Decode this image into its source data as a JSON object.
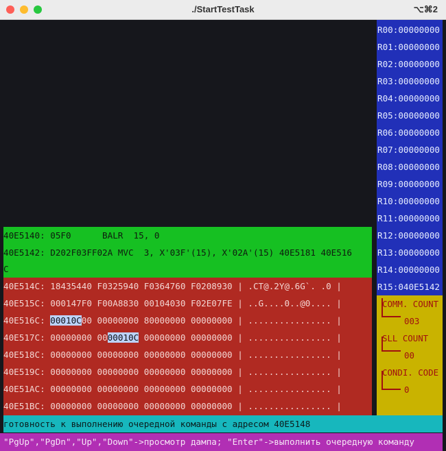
{
  "window": {
    "title": "./StartTestTask",
    "shortcut": "⌥⌘2"
  },
  "disasm": [
    "40E5140: 05F0      BALR  15, 0",
    "40E5142: D202F03FF02A MVC  3, X'03F'(15), X'02A'(15) 40E5181 40E516",
    "C"
  ],
  "dump": [
    {
      "addr": "40E514C:",
      "pre": "",
      "hl": "",
      "mid": "18435440 F0325940 F0364760 F0208930",
      "hl2": "",
      "post": "",
      "ascii": " | .CT@.2Y@.6G`. .0 |"
    },
    {
      "addr": "40E515C:",
      "pre": "",
      "hl": "",
      "mid": "000147F0 F00A8830 00104030 F02E07FE",
      "hl2": "",
      "post": "",
      "ascii": " | ..G....0..@0.... |"
    },
    {
      "addr": "40E516C:",
      "pre": "",
      "hl": "00010C",
      "mid": "00 00000000 80000000 00000000",
      "hl2": "",
      "post": "",
      "ascii": " | ................ |"
    },
    {
      "addr": "40E517C:",
      "pre": "",
      "hl": "",
      "mid": "00000000 00",
      "hl2": "00010C",
      "post": " 00000000 00000000",
      "ascii": " | ................ |"
    },
    {
      "addr": "40E518C:",
      "pre": "",
      "hl": "",
      "mid": "00000000 00000000 00000000 00000000",
      "hl2": "",
      "post": "",
      "ascii": " | ................ |"
    },
    {
      "addr": "40E519C:",
      "pre": "",
      "hl": "",
      "mid": "00000000 00000000 00000000 00000000",
      "hl2": "",
      "post": "",
      "ascii": " | ................ |"
    },
    {
      "addr": "40E51AC:",
      "pre": "",
      "hl": "",
      "mid": "00000000 00000000 00000000 00000000",
      "hl2": "",
      "post": "",
      "ascii": " | ................ |"
    },
    {
      "addr": "40E51BC:",
      "pre": "",
      "hl": "",
      "mid": "00000000 00000000 00000000 00000000",
      "hl2": "",
      "post": "",
      "ascii": " | ................ |"
    }
  ],
  "registers": [
    "R00:00000000",
    "R01:00000000",
    "R02:00000000",
    "R03:00000000",
    "R04:00000000",
    "R05:00000000",
    "R06:00000000",
    "R07:00000000",
    "R08:00000000",
    "R09:00000000",
    "R10:00000000",
    "R11:00000000",
    "R12:00000000",
    "R13:00000000",
    "R14:00000000",
    "R15:040E5142"
  ],
  "counters": [
    {
      "label": "COMM. COUNT",
      "value": "003"
    },
    {
      "label": "SLL COUNT",
      "value": "00"
    },
    {
      "label": "CONDI. CODE",
      "value": "0"
    }
  ],
  "status": "готовность к выполнению очередной команды с адресом 40E5148",
  "hint": "\"PgUp\",\"PgDn\",\"Up\",\"Down\"->просмотр дампа; \"Enter\"->выполнить очередную команду"
}
